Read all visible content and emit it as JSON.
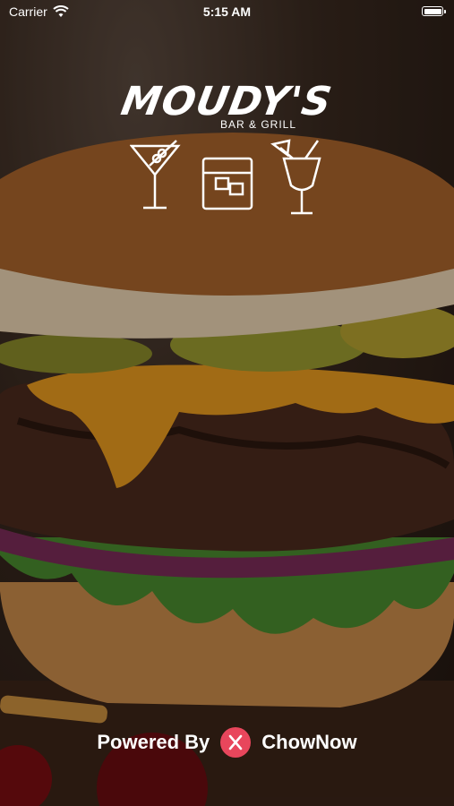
{
  "status": {
    "carrier": "Carrier",
    "time": "5:15 AM"
  },
  "logo": {
    "name": "MOUDY'S",
    "subtitle": "BAR & GRILL"
  },
  "footer": {
    "powered_by": "Powered By",
    "brand": "ChowNow",
    "brand_color": "#e8465c"
  },
  "icons": [
    "martini-glass-icon",
    "whiskey-glass-icon",
    "cocktail-glass-icon",
    "wifi-icon",
    "battery-icon",
    "chownow-logo-icon"
  ]
}
